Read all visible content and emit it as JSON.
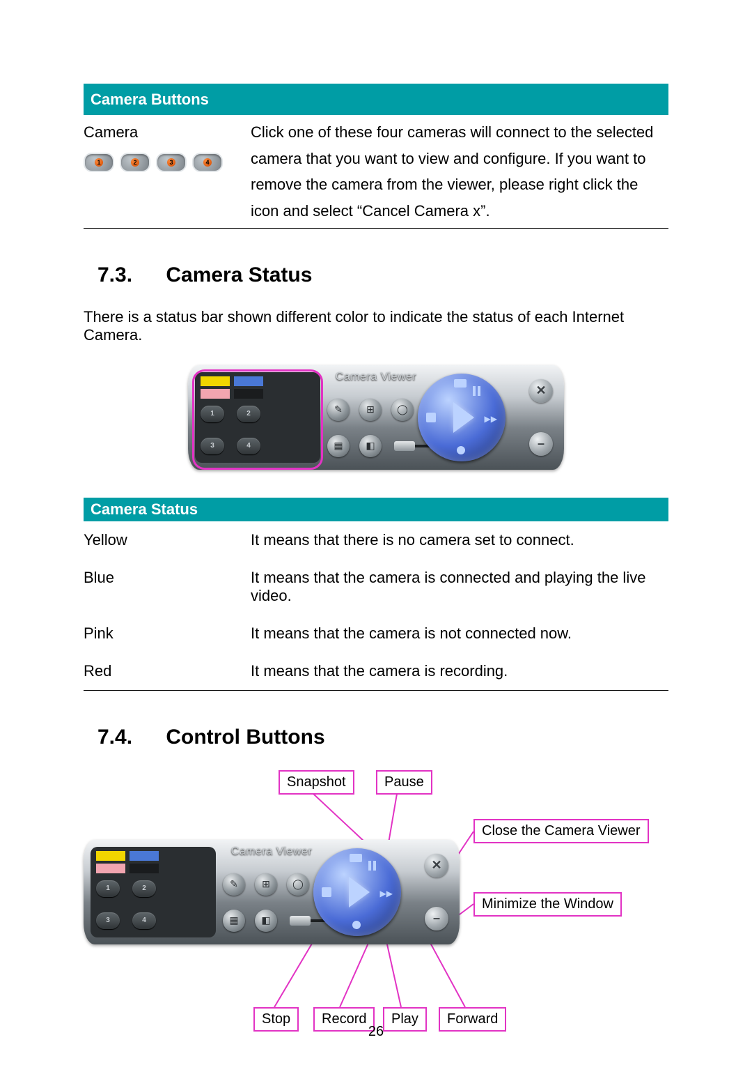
{
  "section_buttons": {
    "header": "Camera Buttons",
    "label": "Camera",
    "pills": [
      "1",
      "2",
      "3",
      "4"
    ],
    "description": "Click one of these four cameras will connect to the selected camera that you want to view and configure. If you want to remove the camera from the viewer, please right click the icon and select “Cancel Camera x”."
  },
  "section_73": {
    "number": "7.3.",
    "title": "Camera Status",
    "intro": "There is a status bar shown different color to indicate the status of each Internet Camera.",
    "panel_title": "Camera Viewer",
    "table_header": "Camera Status",
    "rows": [
      {
        "color": "Yellow",
        "desc": "It means that there is no camera set to connect."
      },
      {
        "color": "Blue",
        "desc": "It means that the camera is connected and playing the live video."
      },
      {
        "color": "Pink",
        "desc": "It means that the camera is not connected now."
      },
      {
        "color": "Red",
        "desc": "It means that the camera is recording."
      }
    ]
  },
  "section_74": {
    "number": "7.4.",
    "title": "Control Buttons",
    "panel_title": "Camera Viewer",
    "labels": {
      "snapshot": "Snapshot",
      "pause": "Pause",
      "close": "Close the Camera Viewer",
      "minimize": "Minimize the Window",
      "stop": "Stop",
      "record": "Record",
      "play": "Play",
      "forward": "Forward"
    }
  },
  "page_number": "26"
}
